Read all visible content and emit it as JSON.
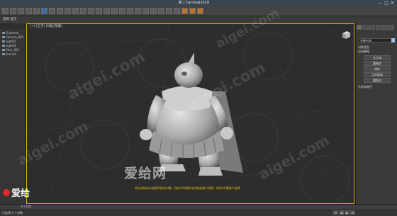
{
  "app": {
    "title": "新 | Carnival2018",
    "window_controls": [
      "—",
      "□",
      "✕"
    ]
  },
  "ribbon": {
    "label": "选择 显示"
  },
  "explorer": {
    "items": [
      {
        "label": "[Camera]"
      },
      {
        "label": "Camera_001"
      },
      {
        "label": "Light01"
      },
      {
        "label": "Light02"
      },
      {
        "label": "Char_001"
      },
      {
        "label": "Ground"
      }
    ]
  },
  "viewport": {
    "label": "[+] [正交] [线框/隐藏]",
    "prompt": "单击并拖动以选择并移动对象，按住Ctrl键单击添加或减少选择，按住Alt键减少选择"
  },
  "watermarks": {
    "main": "爱给网",
    "logo": "爱给",
    "site": "aigei.com"
  },
  "command_panel": {
    "name_field": "对象名称",
    "sections": [
      "对象类型",
      "自动栅格",
      "名称和颜色"
    ],
    "buttons": [
      "长方体",
      "圆锥体",
      "球体",
      "几何球体",
      "圆柱体"
    ],
    "bottom_button": "名称和颜色",
    "accent": "#e0b000",
    "swatch": "#8fc0e8"
  },
  "timeline": {
    "frame": "0 / 100"
  },
  "status": {
    "text": "已选择 1 个对象",
    "controls": [
      "⏮",
      "◀",
      "▶",
      "⏭"
    ]
  }
}
